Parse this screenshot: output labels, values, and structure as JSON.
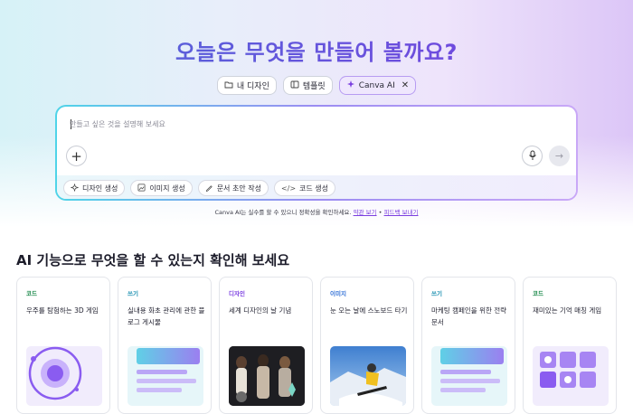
{
  "title": "오늘은 무엇을 만들어 볼까요?",
  "tabs": [
    {
      "label": "내 디자인",
      "icon": "folder-icon"
    },
    {
      "label": "템플릿",
      "icon": "template-icon"
    },
    {
      "label": "Canva AI",
      "icon": "sparkle-icon",
      "active": true
    }
  ],
  "composer": {
    "placeholder": "만들고 싶은 것을 설명해 보세요",
    "chips": [
      {
        "label": "디자인 생성",
        "icon": "sparkle-icon"
      },
      {
        "label": "이미지 생성",
        "icon": "image-icon"
      },
      {
        "label": "문서 초안 작성",
        "icon": "pen-icon"
      },
      {
        "label": "코드 생성",
        "icon": "code-icon"
      }
    ]
  },
  "disclaimer": {
    "text": "Canva AI는 실수를 할 수 있으니 정확성을 확인하세요.",
    "link1": "약관 보기",
    "separator": "•",
    "link2": "피드백 보내기"
  },
  "section_title": "AI 기능으로 무엇을 할 수 있는지 확인해 보세요",
  "cards": [
    {
      "tag": "코드",
      "tag_color": "#1e8a4c",
      "title": "우주를 탐험하는 3D 게임",
      "thumb": "orbit"
    },
    {
      "tag": "쓰기",
      "tag_color": "#1a8fb0",
      "title": "실내용 화초 관리에 관한 블로그 게시물",
      "thumb": "doc"
    },
    {
      "tag": "디자인",
      "tag_color": "#7b3fe0",
      "title": "세계 디자인의 날 기념",
      "thumb": "photo-people"
    },
    {
      "tag": "이미지",
      "tag_color": "#2f6fd6",
      "title": "눈 오는 날에 스노보드 타기",
      "thumb": "photo-snow"
    },
    {
      "tag": "쓰기",
      "tag_color": "#1a8fb0",
      "title": "마케팅 캠페인을 위한 전략 문서",
      "thumb": "doc"
    },
    {
      "tag": "코드",
      "tag_color": "#1e8a4c",
      "title": "재미있는 기억 매칭 게임",
      "thumb": "grid"
    }
  ]
}
